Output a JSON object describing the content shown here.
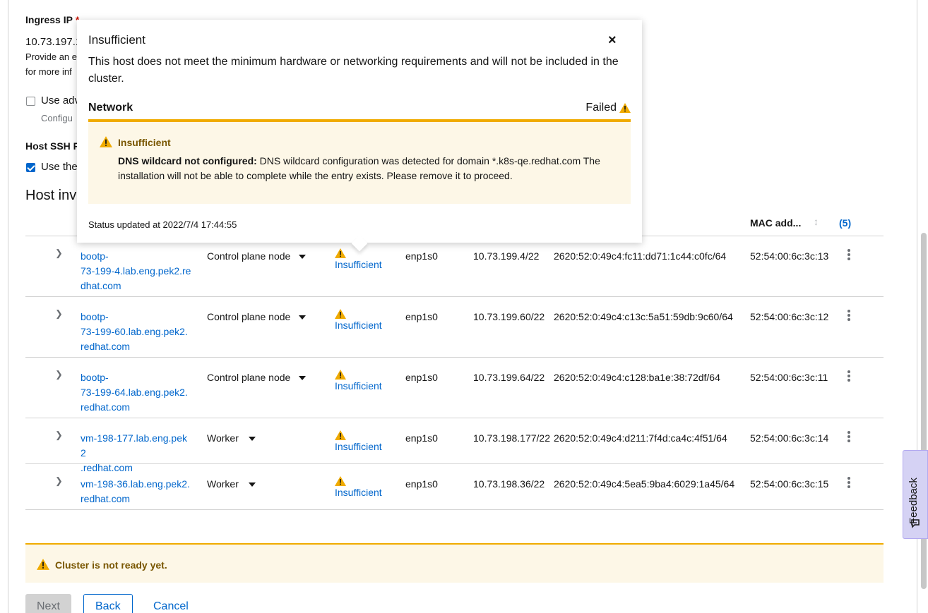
{
  "form": {
    "ingress_label": "Ingress IP",
    "ingress_required": "*",
    "ingress_value": "10.73.197.18",
    "ingress_helper_1": "Provide an e",
    "ingress_helper_2": "for more inf",
    "advanced_label": "Use adv",
    "advanced_helper": "Configu",
    "ssh_label": "Host SSH P",
    "ssh_use_label": "Use the",
    "inventory_title": "Host inv"
  },
  "table": {
    "mac_header": "MAC add...",
    "count": "(5)",
    "rows": [
      {
        "host": "bootp-73-199-4.lab.eng.pek2.redhat.com",
        "host_lines": [
          "bootp-",
          "73-199-4.lab.eng.pek2.re",
          "dhat.com"
        ],
        "role": "Control plane node",
        "status": "Insufficient",
        "nic": "enp1s0",
        "ipv4": "10.73.199.4/22",
        "ipv6": "2620:52:0:49c4:fc11:dd71:1c44:c0fc/64",
        "mac": "52:54:00:6c:3c:13"
      },
      {
        "host": "bootp-73-199-60.lab.eng.pek2.redhat.com",
        "host_lines": [
          "bootp-",
          "73-199-60.lab.eng.pek2.",
          "redhat.com"
        ],
        "role": "Control plane node",
        "status": "Insufficient",
        "nic": "enp1s0",
        "ipv4": "10.73.199.60/22",
        "ipv6": "2620:52:0:49c4:c13c:5a51:59db:9c60/64",
        "mac": "52:54:00:6c:3c:12"
      },
      {
        "host": "bootp-73-199-64.lab.eng.pek2.redhat.com",
        "host_lines": [
          "bootp-",
          "73-199-64.lab.eng.pek2.",
          "redhat.com"
        ],
        "role": "Control plane node",
        "status": "Insufficient",
        "nic": "enp1s0",
        "ipv4": "10.73.199.64/22",
        "ipv6": "2620:52:0:49c4:c128:ba1e:38:72df/64",
        "mac": "52:54:00:6c:3c:11"
      },
      {
        "host": "vm-198-177.lab.eng.pek2.redhat.com",
        "host_lines": [
          "vm-198-177.lab.eng.pek2",
          ".redhat.com"
        ],
        "role": "Worker",
        "status": "Insufficient",
        "nic": "enp1s0",
        "ipv4": "10.73.198.177/22",
        "ipv6": "2620:52:0:49c4:d211:7f4d:ca4c:4f51/64",
        "mac": "52:54:00:6c:3c:14"
      },
      {
        "host": "vm-198-36.lab.eng.pek2.redhat.com",
        "host_lines": [
          "vm-198-36.lab.eng.pek2.",
          "redhat.com"
        ],
        "role": "Worker",
        "status": "Insufficient",
        "nic": "enp1s0",
        "ipv4": "10.73.198.36/22",
        "ipv6": "2620:52:0:49c4:5ea5:9ba4:6029:1a45/64",
        "mac": "52:54:00:6c:3c:15"
      }
    ]
  },
  "cluster_alert": "Cluster is not ready yet.",
  "buttons": {
    "next": "Next",
    "back": "Back",
    "cancel": "Cancel"
  },
  "feedback": "Feedback",
  "popover": {
    "title": "Insufficient",
    "close": "×",
    "body": "This host does not meet the minimum hardware or networking requirements and will not be included in the cluster.",
    "section": "Network",
    "section_status": "Failed",
    "alert_title": "Insufficient",
    "alert_strong": "DNS wildcard not configured:",
    "alert_text": " DNS wildcard configuration was detected for domain *.k8s-qe.redhat.com The installation will not be able to complete while the entry exists. Please remove it to proceed.",
    "footer": "Status updated at 2022/7/4 17:44:55"
  },
  "colors": {
    "warning": "#f0ab00",
    "link": "#0066cc",
    "alert_bg": "#fdf7e7"
  },
  "icons": [
    "warning-icon",
    "close-icon",
    "kebab-icon",
    "chevron-right-icon",
    "caret-down-icon",
    "sort-icon",
    "feedback-icon"
  ]
}
